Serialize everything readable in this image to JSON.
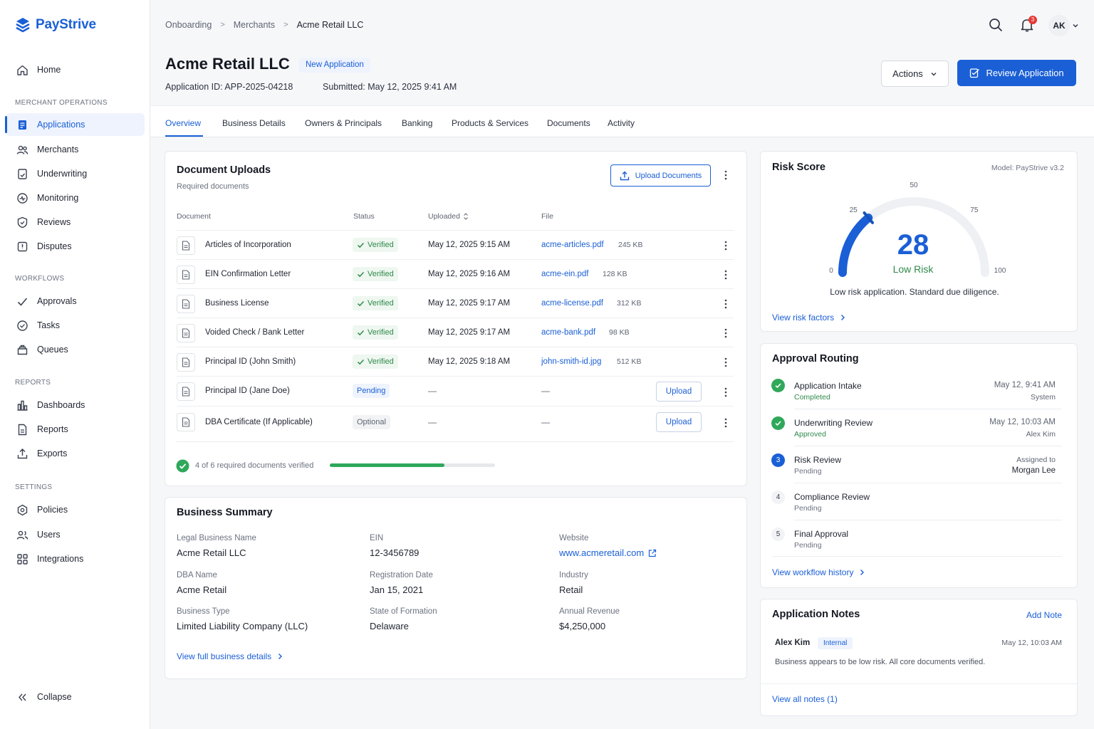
{
  "app": {
    "name": "PayStrive",
    "brand_color": "#1a5fd6"
  },
  "sidebar": {
    "home": "Home",
    "sections": {
      "merchant_ops": "MERCHANT OPERATIONS",
      "workflows": "WORKFLOWS",
      "reports": "REPORTS",
      "settings": "SETTINGS"
    },
    "items": {
      "applications": "Applications",
      "merchants": "Merchants",
      "underwriting": "Underwriting",
      "monitoring": "Monitoring",
      "reviews": "Reviews",
      "disputes": "Disputes",
      "approvals": "Approvals",
      "tasks": "Tasks",
      "queues": "Queues",
      "dashboards": "Dashboards",
      "reports": "Reports",
      "exports": "Exports",
      "policies": "Policies",
      "users": "Users",
      "integrations": "Integrations"
    },
    "collapse": "Collapse"
  },
  "header": {
    "breadcrumb": [
      "Onboarding",
      "Merchants",
      "Acme Retail LLC"
    ],
    "notification_count": "3",
    "avatar_initials": "AK",
    "title": "Acme Retail LLC",
    "status": "New Application",
    "application_id_label": "Application ID:",
    "application_id": "APP-2025-04218",
    "submitted_label": "Submitted:",
    "submitted": "May 12, 2025 9:41 AM",
    "actions_label": "Actions",
    "review_label": "Review Application"
  },
  "tabs": [
    "Overview",
    "Business Details",
    "Owners & Principals",
    "Banking",
    "Products & Services",
    "Documents",
    "Activity"
  ],
  "documents": {
    "title": "Document Uploads",
    "subtitle": "Required documents",
    "upload_button": "Upload Documents",
    "columns": {
      "document": "Document",
      "status": "Status",
      "uploaded": "Uploaded",
      "file": "File"
    },
    "rows": [
      {
        "name": "Articles of Incorporation",
        "status": "Verified",
        "uploaded": "May 12, 2025 9:15 AM",
        "file": "acme-articles.pdf",
        "size": "245 KB"
      },
      {
        "name": "EIN Confirmation Letter",
        "status": "Verified",
        "uploaded": "May 12, 2025 9:16 AM",
        "file": "acme-ein.pdf",
        "size": "128 KB"
      },
      {
        "name": "Business License",
        "status": "Verified",
        "uploaded": "May 12, 2025 9:17 AM",
        "file": "acme-license.pdf",
        "size": "312 KB"
      },
      {
        "name": "Voided Check / Bank Letter",
        "status": "Verified",
        "uploaded": "May 12, 2025 9:17 AM",
        "file": "acme-bank.pdf",
        "size": "98 KB"
      },
      {
        "name": "Principal ID (John Smith)",
        "status": "Verified",
        "uploaded": "May 12, 2025 9:18 AM",
        "file": "john-smith-id.jpg",
        "size": "512 KB"
      },
      {
        "name": "Principal ID (Jane Doe)",
        "status": "Pending",
        "uploaded": "—",
        "file": "—",
        "action": "Upload"
      },
      {
        "name": "DBA Certificate (If Applicable)",
        "status": "Optional",
        "uploaded": "—",
        "file": "—",
        "action": "Upload"
      }
    ],
    "progress_text": "4 of 6 required documents verified",
    "progress_fraction": 0.694
  },
  "summary": {
    "title": "Business Summary",
    "fields": {
      "legal_name": {
        "label": "Legal Business Name",
        "value": "Acme Retail LLC"
      },
      "ein": {
        "label": "EIN",
        "value": "12-3456789"
      },
      "website": {
        "label": "Website",
        "value": "www.acmeretail.com"
      },
      "dba": {
        "label": "DBA Name",
        "value": "Acme Retail"
      },
      "reg_date": {
        "label": "Registration Date",
        "value": "Jan 15, 2021"
      },
      "industry": {
        "label": "Industry",
        "value": "Retail"
      },
      "type": {
        "label": "Business Type",
        "value": "Limited Liability Company (LLC)"
      },
      "state": {
        "label": "State of Formation",
        "value": "Delaware"
      },
      "revenue": {
        "label": "Annual Revenue",
        "value": "$4,250,000"
      }
    },
    "link": "View full business details"
  },
  "risk": {
    "title": "Risk Score",
    "model": "Model: PayStrive v3.2",
    "score": "28",
    "score_value": 28,
    "level": "Low Risk",
    "ticks": [
      "0",
      "25",
      "50",
      "75",
      "100"
    ],
    "description": "Low risk application. Standard due diligence.",
    "link": "View risk factors"
  },
  "routing": {
    "title": "Approval Routing",
    "steps": [
      {
        "title": "Application Intake",
        "status": "Completed",
        "right1": "May 12, 9:41 AM",
        "right2": "System"
      },
      {
        "title": "Underwriting Review",
        "status": "Approved",
        "right1": "May 12, 10:03 AM",
        "right2": "Alex Kim"
      },
      {
        "num": "3",
        "title": "Risk Review",
        "status": "Pending",
        "right1": "Assigned to",
        "right2": "Morgan Lee"
      },
      {
        "num": "4",
        "title": "Compliance Review",
        "status": "Pending"
      },
      {
        "num": "5",
        "title": "Final Approval",
        "status": "Pending"
      }
    ],
    "link": "View workflow history"
  },
  "notes": {
    "title": "Application Notes",
    "add": "Add Note",
    "author": "Alex Kim",
    "tag": "Internal",
    "date": "May 12, 10:03 AM",
    "body": "Business appears to be low risk. All core documents verified.",
    "link": "View all notes (1)"
  }
}
